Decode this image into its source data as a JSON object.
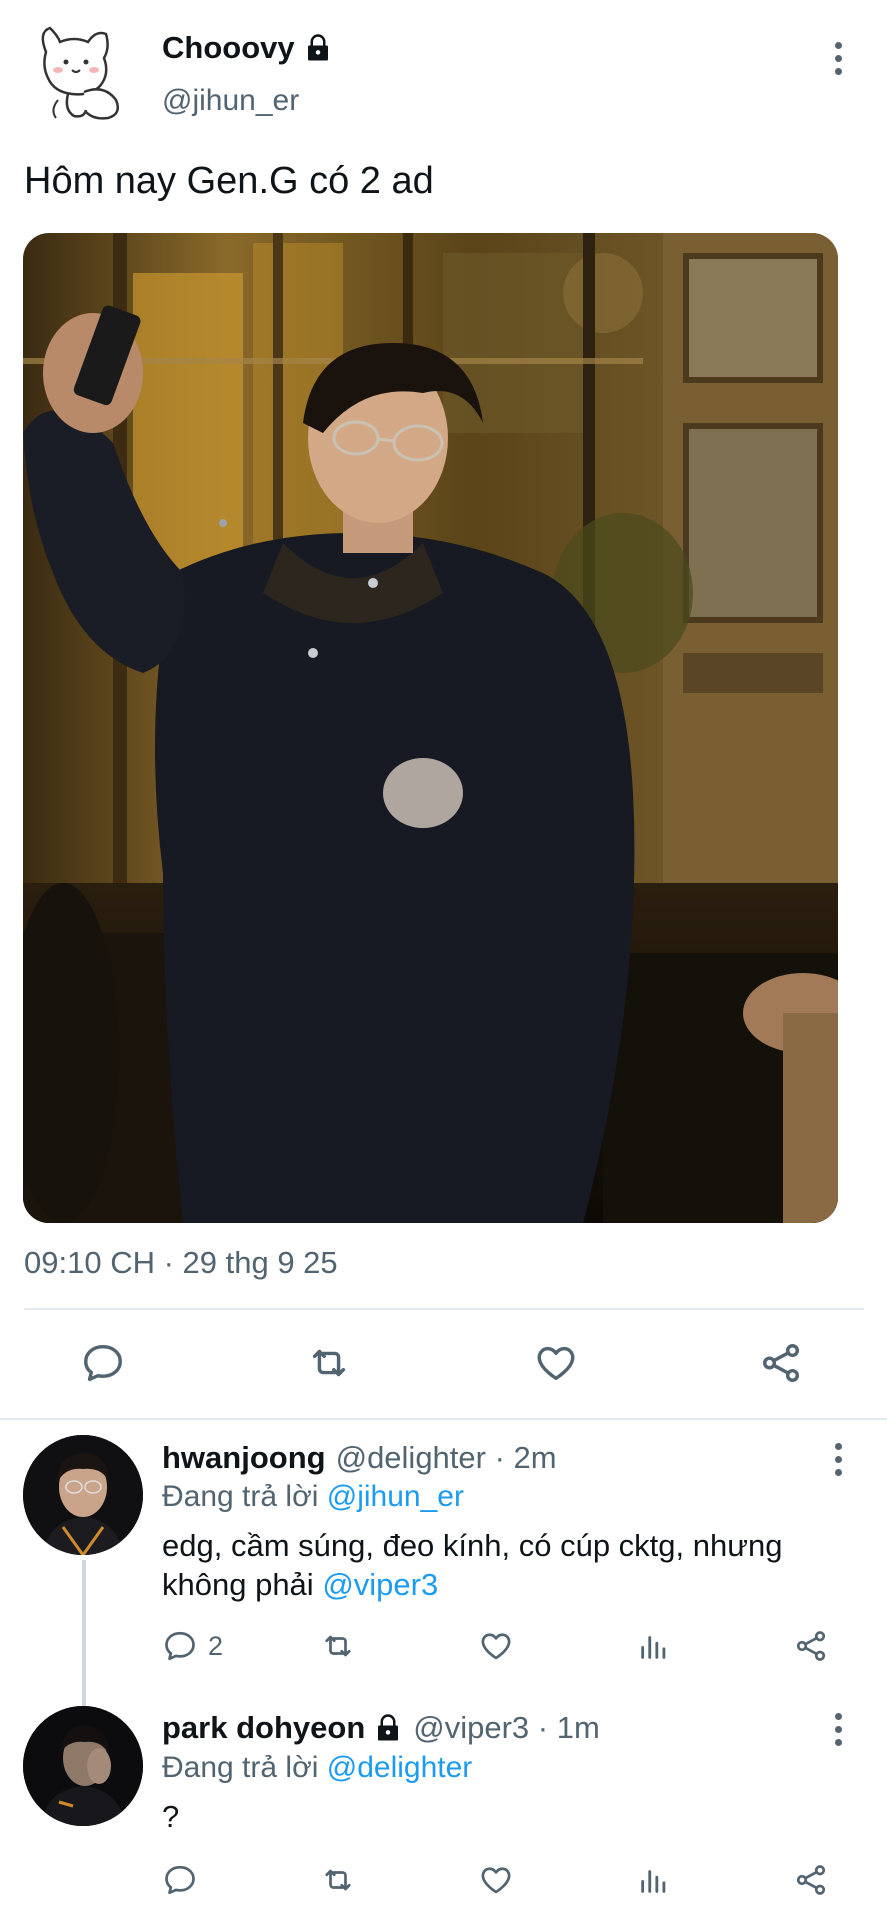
{
  "tweet": {
    "display_name": "Chooovy",
    "handle": "@jihun_er",
    "text": "Hôm nay Gen.G có 2 ad",
    "timestamp": "09:10 CH · 29 thg 9 25"
  },
  "replies": [
    {
      "display_name": "hwanjoong",
      "meta": "@delighter · 2m",
      "replying_prefix": "Đang trả lời",
      "replying_to": "@jihun_er",
      "body_line1": "edg, cầm súng, đeo kính, có cúp cktg, nhưng",
      "body_line2_prefix": "không phải",
      "body_mention": "@viper3",
      "reply_count": "2"
    },
    {
      "display_name": "park dohyeon",
      "meta": "@viper3 · 1m",
      "replying_prefix": "Đang trả lời",
      "replying_to": "@delighter",
      "body": "?"
    }
  ],
  "icons": {
    "lock": "lock-icon",
    "reply": "reply-icon",
    "retweet": "retweet-icon",
    "like": "like-icon",
    "views": "views-icon",
    "share": "share-icon",
    "more": "more-icon"
  },
  "colors": {
    "accent": "#1d9bf0",
    "text": "#0f1419",
    "secondary": "#536471"
  }
}
